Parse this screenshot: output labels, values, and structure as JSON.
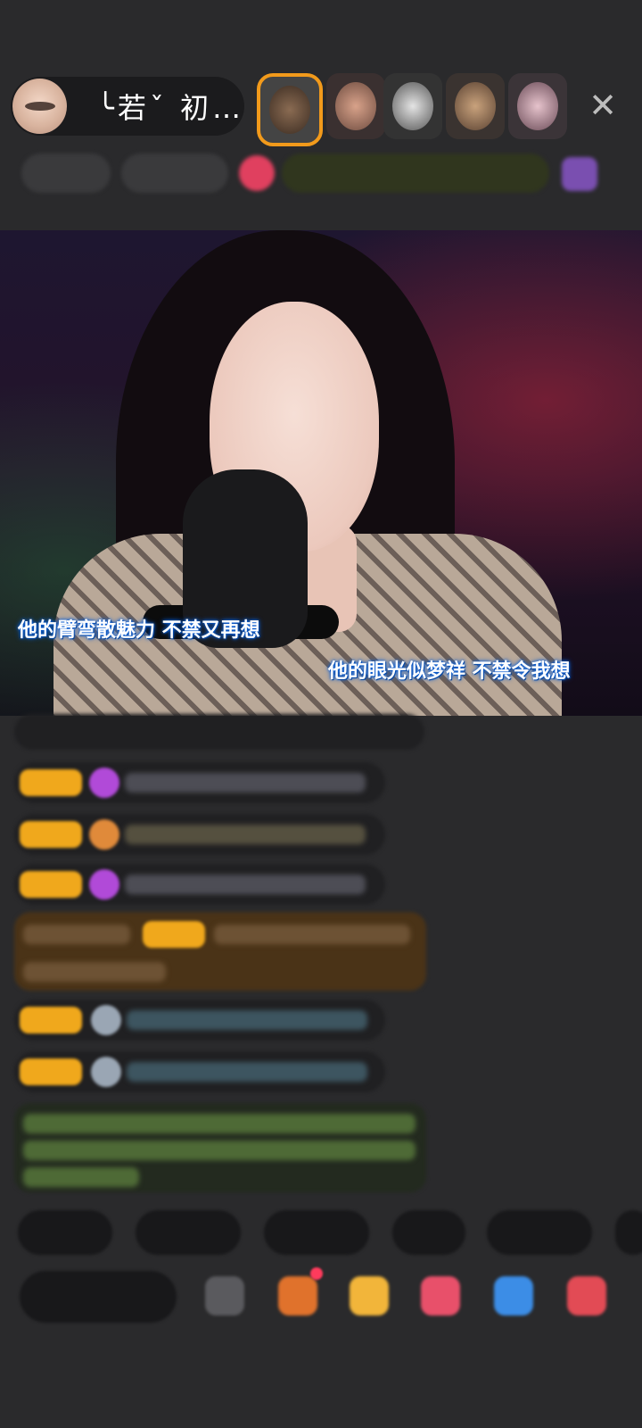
{
  "host": {
    "name": "╰若ˇ 初…",
    "avatar_icon": "host-avatar"
  },
  "top_viewers": [
    {
      "icon": "viewer-avatar-1",
      "ring_color": "#f29a1b"
    },
    {
      "icon": "viewer-avatar-2"
    },
    {
      "icon": "viewer-avatar-3"
    },
    {
      "icon": "viewer-avatar-4"
    },
    {
      "icon": "viewer-avatar-5"
    }
  ],
  "close_label": "✕",
  "video": {
    "lyrics_left": "他的臂弯散魅力 不禁又再想",
    "lyrics_right": "他的眼光似梦祥 不禁令我想"
  },
  "colors": {
    "background": "#2a2a2c",
    "badge": "#f0a81c",
    "gift_highlight": "#5b3a14",
    "system_message": "#2f4a22",
    "lyric_glow": "#0a5fd8"
  }
}
